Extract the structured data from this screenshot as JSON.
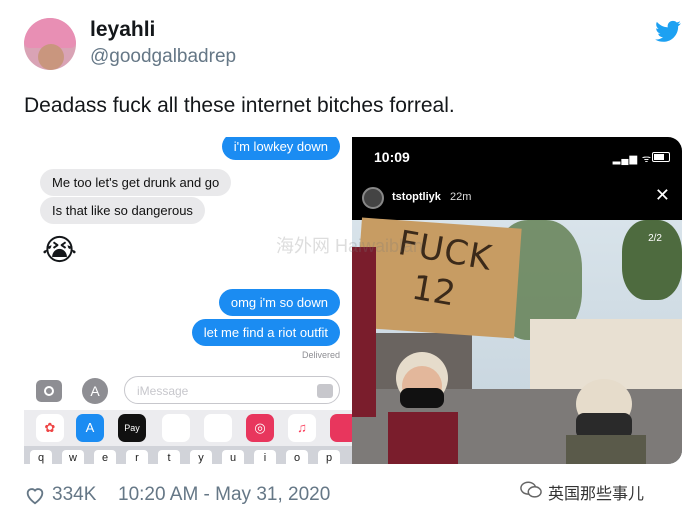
{
  "tweet": {
    "display_name": "leyahli",
    "handle": "@goodgalbadrep",
    "text": "Deadass fuck all these internet bitches forreal.",
    "likes": "334K",
    "datetime": "10:20 AM - May 31, 2020"
  },
  "imessage": {
    "bubbles": [
      {
        "text": "i'm lowkey down",
        "side": "sent"
      },
      {
        "text": "Me too let's get drunk and go",
        "side": "received"
      },
      {
        "text": "Is that like so dangerous",
        "side": "received"
      },
      {
        "text": "omg i'm so down",
        "side": "sent"
      },
      {
        "text": "let me find a riot outfit",
        "side": "sent"
      }
    ],
    "emoji": "😭",
    "delivered": "Delivered",
    "input_placeholder": "iMessage",
    "apps": [
      "photos",
      "app-store",
      "apple-pay",
      "monkey",
      "memoji",
      "search",
      "music",
      "more"
    ],
    "applepay_label": "Pay",
    "keys": [
      "q",
      "w",
      "e",
      "r",
      "t",
      "y",
      "u",
      "i",
      "o",
      "p"
    ]
  },
  "story": {
    "time": "10:09",
    "username": "tstoptliyk",
    "age": "22m",
    "page": "2/2",
    "sign_line1": "FUCK",
    "sign_line2": "12"
  },
  "watermark": "海外网\nHaiwaiblan",
  "brand": "英国那些事儿",
  "colors": {
    "twitter_blue": "#1da1f2",
    "imessage_blue": "#1b8cf2"
  }
}
